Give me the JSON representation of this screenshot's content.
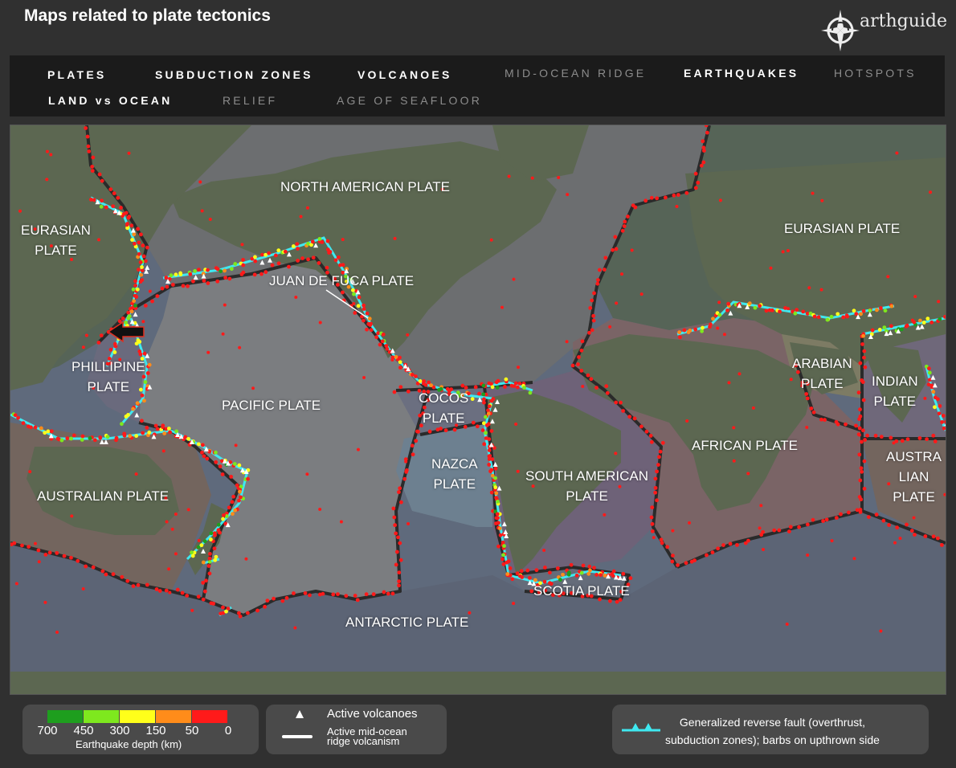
{
  "header": {
    "title": "Maps related to plate tectonics",
    "logo_text": "arthguide"
  },
  "nav": {
    "items": [
      {
        "label": "PLATES",
        "state": "active"
      },
      {
        "label": "SUBDUCTION ZONES",
        "state": "active"
      },
      {
        "label": "VOLCANOES",
        "state": "active"
      },
      {
        "label": "MID-OCEAN RIDGE",
        "state": "inactive"
      },
      {
        "label": "EARTHQUAKES",
        "state": "active"
      },
      {
        "label": "HOTSPOTS",
        "state": "inactive"
      },
      {
        "label": "LAND vs OCEAN",
        "state": "active"
      },
      {
        "label": "RELIEF",
        "state": "inactive"
      },
      {
        "label": "AGE OF SEAFLOOR",
        "state": "inactive"
      }
    ]
  },
  "map": {
    "plates": [
      "EURASIAN PLATE",
      "NORTH AMERICAN PLATE",
      "JUAN DE FUCA PLATE",
      "EURASIAN PLATE",
      "PHILLIPINE PLATE",
      "PACIFIC PLATE",
      "COCOS PLATE",
      "ARABIAN PLATE",
      "INDIAN PLATE",
      "AFRICAN PLATE",
      "NAZCA PLATE",
      "SOUTH AMERICAN PLATE",
      "AUSTRALIAN PLATE",
      "AUSTRALIAN PLATE",
      "SCOTIA PLATE",
      "ANTARCTIC PLATE"
    ],
    "plate_labels": {
      "eurasian_west_line1": "EURASIAN",
      "eurasian_west_line2": "PLATE",
      "north_american": "NORTH AMERICAN PLATE",
      "juan_de_fuca": "JUAN DE FUCA PLATE",
      "eurasian_east": "EURASIAN PLATE",
      "phillipine_line1": "PHILLIPINE",
      "phillipine_line2": "PLATE",
      "pacific": "PACIFIC PLATE",
      "cocos_line1": "COCOS",
      "cocos_line2": "PLATE",
      "arabian_line1": "ARABIAN",
      "arabian_line2": "PLATE",
      "indian_line1": "INDIAN",
      "indian_line2": "PLATE",
      "african": "AFRICAN PLATE",
      "nazca_line1": "NAZCA",
      "nazca_line2": "PLATE",
      "south_american_line1": "SOUTH AMERICAN",
      "south_american_line2": "PLATE",
      "australian_west": "AUSTRALIAN PLATE",
      "australian_east_line1": "AUSTRA",
      "australian_east_line2": "LIAN",
      "australian_east_line3": "PLATE",
      "scotia": "SCOTIA PLATE",
      "antarctic": "ANTARCTIC PLATE"
    },
    "colors": {
      "ocean": "#5f6a7c",
      "land": "#5e6a55",
      "boundary": "#2a2a2a",
      "earthquake": "#ff1a1a",
      "subduction": "#3fe8f0",
      "volcano": "#ffffff",
      "arrow_marker": "#111111"
    }
  },
  "legend": {
    "depth": {
      "colors": [
        "#1e9e1e",
        "#7ee81e",
        "#ffff1a",
        "#ff8c1a",
        "#ff1a1a"
      ],
      "ticks": [
        "700",
        "450",
        "300",
        "150",
        "50",
        "0"
      ],
      "caption": "Earthquake depth (km)"
    },
    "volcanoes": {
      "volcano_label": "Active volcanoes",
      "ridge_label_line1": "Active mid-ocean",
      "ridge_label_line2": "ridge volcanism"
    },
    "fault": {
      "line1": "Generalized reverse fault (overthrust,",
      "line2": "subduction zones); barbs on upthrown side"
    }
  }
}
